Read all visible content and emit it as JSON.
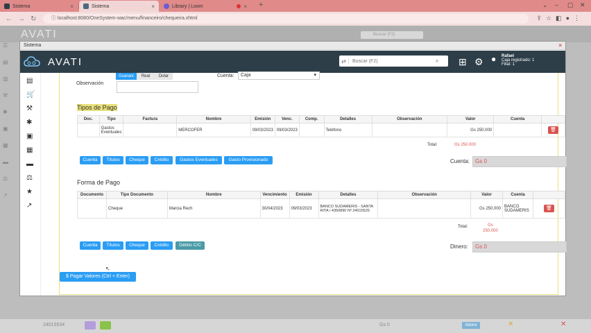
{
  "browser": {
    "tabs": [
      {
        "label": "Sistema",
        "active": false
      },
      {
        "label": "Sistema",
        "active": true
      },
      {
        "label": "Library | Loom",
        "active": false
      }
    ],
    "url": "localhost:8080/OneSystem-wac/menu/financeiro/chequeira.xhtml"
  },
  "bg_app": {
    "logo": "AVATI",
    "search_placeholder": "Buscar (F2)",
    "bottom_left": "24015534",
    "bottom_mid": "Gs 0",
    "bottom_badge": "Abono"
  },
  "modal": {
    "title": "Sistema",
    "close": "×"
  },
  "header": {
    "logo": "AVATI",
    "search_placeholder": "Buscar (F2)",
    "user_name": "Rafael",
    "user_caja": "Caja registrado: 1",
    "user_filial": "Filial: 1"
  },
  "top_form": {
    "currency_options": [
      "Guaraní",
      "Real",
      "Dolar"
    ],
    "cuenta_label": "Cuenta:",
    "cuenta_value": "Caja",
    "observacion_label": "Observación"
  },
  "tipos_de_pago": {
    "title": "Tipos de Pago",
    "columns": [
      "Doc.",
      "Tipo",
      "Factura",
      "Nombre",
      "Emisión",
      "Venc.",
      "Comp.",
      "Detalles",
      "Observación",
      "Valor",
      "Cuenta",
      ""
    ],
    "rows": [
      {
        "doc": "",
        "tipo": "Gastos Eventuales",
        "factura": "",
        "nombre": "MERCOFER",
        "emision": "09/03/2023",
        "venc": "09/03/2023",
        "comp": "",
        "detalles": "Teléfono",
        "observacion": "",
        "valor": "Gs 250.000",
        "cuenta": ""
      }
    ],
    "total_label": "Total:",
    "total_value": "Gs 250.000",
    "buttons": [
      "Cuenta",
      "Títulos",
      "Cheque",
      "Crédito",
      "Gastos Eventuales",
      "Gasto Provisionado"
    ],
    "cuenta_sum_label": "Cuenta:",
    "cuenta_sum_value": "Gs 0"
  },
  "forma_de_pago": {
    "title": "Forma de Pago",
    "columns": [
      "Documento",
      "Tipo Documento",
      "Nombre",
      "Vencimiento",
      "Emisión",
      "Detalles",
      "Observación",
      "Valor",
      "Cuenta",
      ""
    ],
    "rows": [
      {
        "documento": "",
        "tipo": "Cheque",
        "nombre": "Marcia Rech",
        "vencimiento": "30/04/2023",
        "emision": "09/03/2023",
        "detalles": "BANCO SUDAMERIS - SANTA RITA / 4350890 Nº 24015525",
        "observacion": "",
        "valor": "Gs 250.000",
        "cuenta": "BANCO SUDAMERIS"
      }
    ],
    "total_label": "Total:",
    "total_value": "Gs 250.000",
    "buttons": [
      "Cuenta",
      "Títulos",
      "Cheque",
      "Crédito",
      "Débito C/C"
    ],
    "dinero_label": "Dinero:",
    "dinero_value": "Gs 0"
  },
  "pay_button": "Pagar Valores (Ctrl + Enter)",
  "colors": {
    "header_bg": "#2d3e48",
    "primary_button": "#2a9df4",
    "danger": "#d9534f",
    "tab_bar": "#e08a8a"
  }
}
